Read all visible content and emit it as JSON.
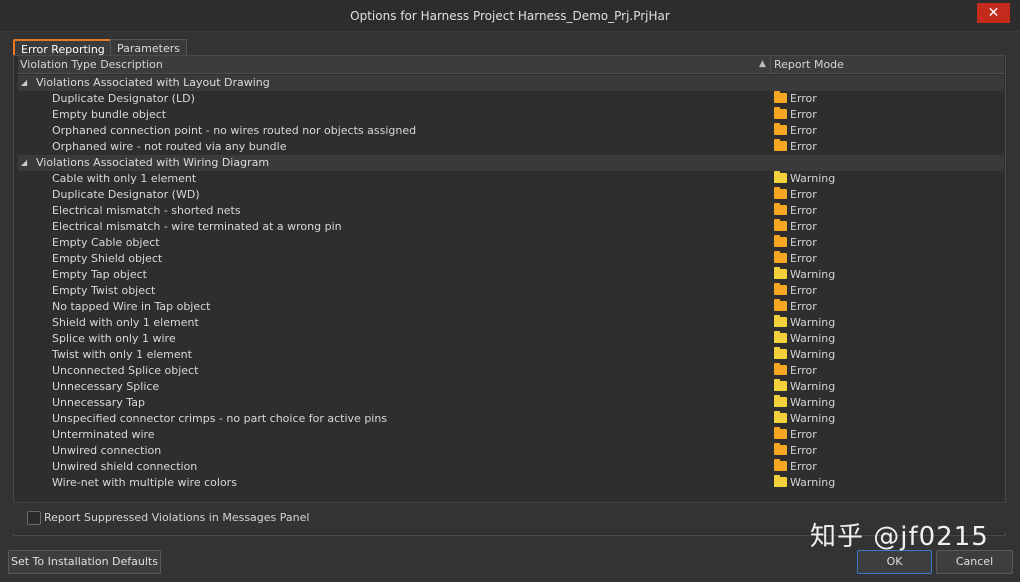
{
  "window": {
    "title": "Options for Harness Project Harness_Demo_Prj.PrjHar",
    "close_glyph": "✕"
  },
  "tabs": [
    {
      "label": "Error Reporting",
      "active": true
    },
    {
      "label": "Parameters",
      "active": false
    }
  ],
  "grid": {
    "col_description": "Violation Type Description",
    "col_mode": "Report Mode",
    "sort_glyph": "▲"
  },
  "groups": [
    {
      "label": "Violations Associated with Layout Drawing",
      "expander": "◢",
      "items": [
        {
          "label": "Duplicate Designator (LD)",
          "mode": "Error"
        },
        {
          "label": "Empty bundle object",
          "mode": "Error"
        },
        {
          "label": "Orphaned connection point - no wires routed nor objects assigned",
          "mode": "Error"
        },
        {
          "label": "Orphaned wire - not routed via any bundle",
          "mode": "Error"
        }
      ]
    },
    {
      "label": "Violations Associated with Wiring Diagram",
      "expander": "◢",
      "items": [
        {
          "label": "Cable with only 1 element",
          "mode": "Warning"
        },
        {
          "label": "Duplicate Designator (WD)",
          "mode": "Error"
        },
        {
          "label": "Electrical mismatch - shorted nets",
          "mode": "Error"
        },
        {
          "label": "Electrical mismatch - wire terminated at a wrong pin",
          "mode": "Error"
        },
        {
          "label": "Empty Cable object",
          "mode": "Error"
        },
        {
          "label": "Empty Shield object",
          "mode": "Error"
        },
        {
          "label": "Empty Tap object",
          "mode": "Warning"
        },
        {
          "label": "Empty Twist object",
          "mode": "Error"
        },
        {
          "label": "No tapped Wire in Tap object",
          "mode": "Error"
        },
        {
          "label": "Shield with only 1 element",
          "mode": "Warning"
        },
        {
          "label": "Splice with only 1 wire",
          "mode": "Warning"
        },
        {
          "label": "Twist with only 1 element",
          "mode": "Warning"
        },
        {
          "label": "Unconnected Splice object",
          "mode": "Error"
        },
        {
          "label": "Unnecessary Splice",
          "mode": "Warning"
        },
        {
          "label": "Unnecessary Tap",
          "mode": "Warning"
        },
        {
          "label": "Unspecified connector crimps - no part choice for active pins",
          "mode": "Warning"
        },
        {
          "label": "Unterminated wire",
          "mode": "Error"
        },
        {
          "label": "Unwired connection",
          "mode": "Error"
        },
        {
          "label": "Unwired shield connection",
          "mode": "Error"
        },
        {
          "label": "Wire-net with multiple wire colors",
          "mode": "Warning"
        }
      ]
    }
  ],
  "footer": {
    "checkbox_label": "Report Suppressed Violations in Messages Panel",
    "checkbox_checked": false,
    "defaults_button": "Set To Installation Defaults",
    "ok_button": "OK",
    "cancel_button": "Cancel"
  },
  "watermark": "知乎 @jf0215",
  "colors": {
    "error_folder": "#f5a623",
    "warning_folder": "#f2d13a",
    "active_tab_border": "#e87722",
    "close_button": "#c42b1c"
  }
}
